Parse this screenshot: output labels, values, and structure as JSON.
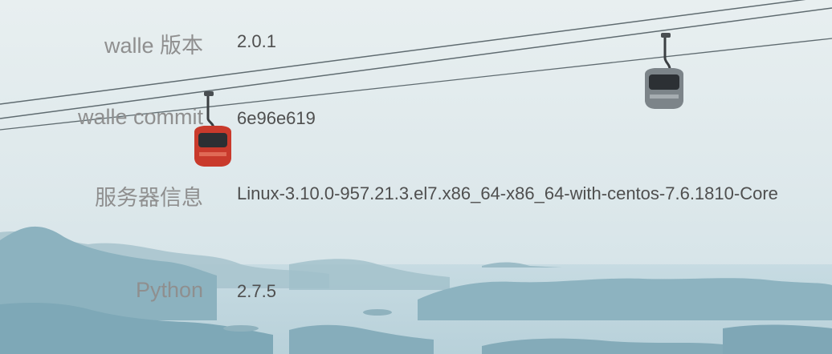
{
  "info": {
    "rows": [
      {
        "label": "walle 版本",
        "value": "2.0.1"
      },
      {
        "label": "walle commit",
        "value": "6e96e619"
      },
      {
        "label": "服务器信息",
        "value": "Linux-3.10.0-957.21.3.el7.x86_64-x86_64-with-centos-7.6.1810-Core"
      },
      {
        "label": "Python",
        "value": "2.7.5"
      }
    ]
  },
  "colors": {
    "sky": "#dfe9ec",
    "mountain": "#8fb4c0",
    "label": "#8f8f8f",
    "value": "#4f4f4f"
  },
  "icons": {
    "left_cablecar": "red-cable-car-icon",
    "right_cablecar": "gray-cable-car-icon"
  }
}
